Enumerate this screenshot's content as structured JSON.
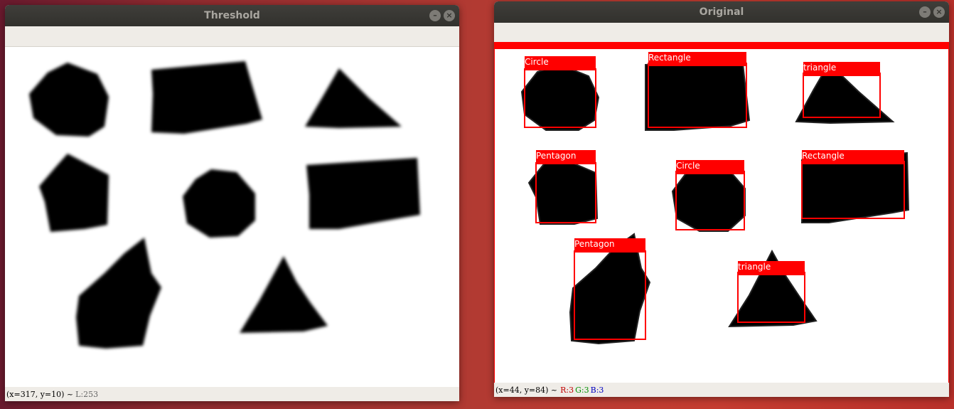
{
  "threshold_window": {
    "title": "Threshold",
    "status": {
      "coords": "(x=317, y=10) ~",
      "luminance": "L:253"
    }
  },
  "original_window": {
    "title": "Original",
    "status": {
      "coords": "(x=44, y=84) ~",
      "red": "R:3",
      "green": "G:3",
      "blue": "B:3"
    }
  },
  "detections": [
    {
      "label": "Circle"
    },
    {
      "label": "Rectangle"
    },
    {
      "label": "triangle"
    },
    {
      "label": "Pentagon"
    },
    {
      "label": "Circle"
    },
    {
      "label": "Rectangle"
    },
    {
      "label": "Pentagon"
    },
    {
      "label": "triangle"
    }
  ],
  "colors": {
    "box": "#ff0000",
    "shape": "#000000",
    "titlebar": "#3a3935"
  },
  "icons": {
    "minimize": "minimize-icon",
    "close": "close-icon"
  }
}
